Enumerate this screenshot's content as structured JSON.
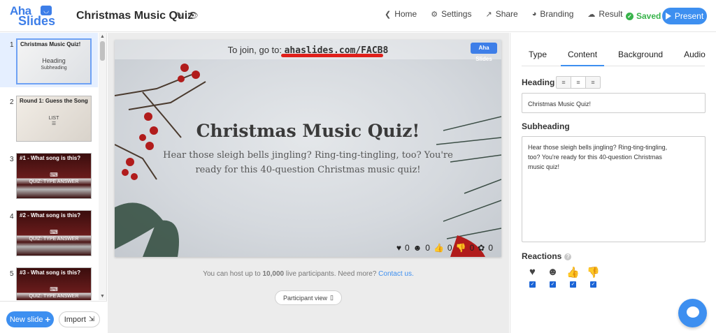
{
  "header": {
    "logo_line1": "Aha",
    "logo_line2": "Slides",
    "title": "Christmas Music Quiz",
    "nav": [
      {
        "label": "Home",
        "icon": "chevron-left-icon"
      },
      {
        "label": "Settings",
        "icon": "gear-icon"
      },
      {
        "label": "Share",
        "icon": "share-icon"
      },
      {
        "label": "Branding",
        "icon": "palette-icon"
      },
      {
        "label": "Result",
        "icon": "cloud-download-icon"
      }
    ],
    "saved_label": "Saved",
    "present_label": "Present"
  },
  "sidebar": {
    "slides": [
      {
        "num": "1",
        "title": "Christmas Music Quiz!",
        "heading": "Heading",
        "subheading": "Subheading"
      },
      {
        "num": "2",
        "title": "Round 1: Guess the Song",
        "kind": "LIST"
      },
      {
        "num": "3",
        "title": "#1 - What song is this?",
        "kind": "QUIZ: TYPE ANSWER"
      },
      {
        "num": "4",
        "title": "#2 - What song is this?",
        "kind": "QUIZ: TYPE ANSWER"
      },
      {
        "num": "5",
        "title": "#3 - What song is this?",
        "kind": "QUIZ: TYPE ANSWER"
      }
    ],
    "new_slide_label": "New slide",
    "import_label": "Import"
  },
  "canvas": {
    "join_prefix": "To join, go to:",
    "join_url": "ahaslides.com/FACB8",
    "stage_logo_line1": "Aha",
    "stage_logo_line2": "Slides",
    "heading": "Christmas Music Quiz!",
    "subheading": "Hear those sleigh bells jingling? Ring-ting-tingling, too? You're ready for this 40-question Christmas music quiz!",
    "reaction_counts": [
      "0",
      "0",
      "0",
      "0",
      "0"
    ],
    "info_prefix": "You can host up to",
    "info_bold": "10,000",
    "info_suffix": "live participants. Need more?",
    "info_link": "Contact us.",
    "participant_view_label": "Participant view"
  },
  "panel": {
    "tabs": [
      "Type",
      "Content",
      "Background",
      "Audio"
    ],
    "active_tab": "Content",
    "heading_label": "Heading",
    "heading_value": "Christmas Music Quiz!",
    "subheading_label": "Subheading",
    "subheading_value": "Hear those sleigh bells jingling? Ring-ting-tingling, too? You're ready for this 40-question Christmas music quiz!",
    "reactions_label": "Reactions",
    "reactions": [
      "heart-icon",
      "smile-icon",
      "thumbs-up-icon",
      "thumbs-down-icon"
    ]
  },
  "colors": {
    "brand_blue": "#3d8ff0",
    "saved_green": "#37b34a",
    "underline_red": "#e0201b"
  }
}
